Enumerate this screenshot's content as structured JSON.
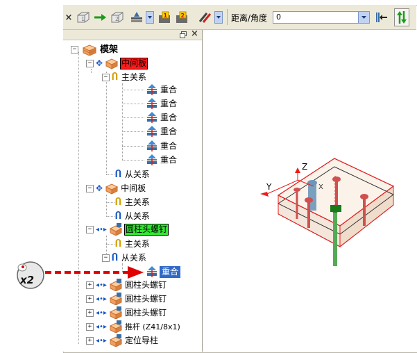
{
  "toolbar": {
    "distance_angle_label": "距离/角度",
    "distance_value": "0"
  },
  "tree": {
    "root": "模架",
    "nodes": [
      {
        "label": "中间板",
        "highlight": "#ff1a1a"
      },
      {
        "label": "主关系"
      },
      {
        "label": "重合"
      },
      {
        "label": "重合"
      },
      {
        "label": "重合"
      },
      {
        "label": "重合"
      },
      {
        "label": "重合"
      },
      {
        "label": "重合"
      },
      {
        "label": "从关系"
      },
      {
        "label": "中间板"
      },
      {
        "label": "主关系"
      },
      {
        "label": "从关系"
      },
      {
        "label": "圆柱头螺钉",
        "highlight": "#33e633"
      },
      {
        "label": "主关系"
      },
      {
        "label": "从关系"
      },
      {
        "label": "重合",
        "highlight": "#3169c6"
      },
      {
        "label": "圆柱头螺钉"
      },
      {
        "label": "圆柱头螺钉"
      },
      {
        "label": "圆柱头螺钉"
      },
      {
        "label": "推杆 (Z41/8x1)"
      },
      {
        "label": "定位导柱"
      }
    ]
  },
  "annotation": {
    "callout": "x2",
    "arrow_color": "#e00000"
  },
  "viewport": {
    "axis_y": "Y",
    "axis_z": "Z",
    "axis_x": "X"
  },
  "colors": {
    "toolbar_bg": "#ece9d8",
    "selection": "#3169c6",
    "red_highlight": "#ff1a1a",
    "green_highlight": "#33e633"
  }
}
